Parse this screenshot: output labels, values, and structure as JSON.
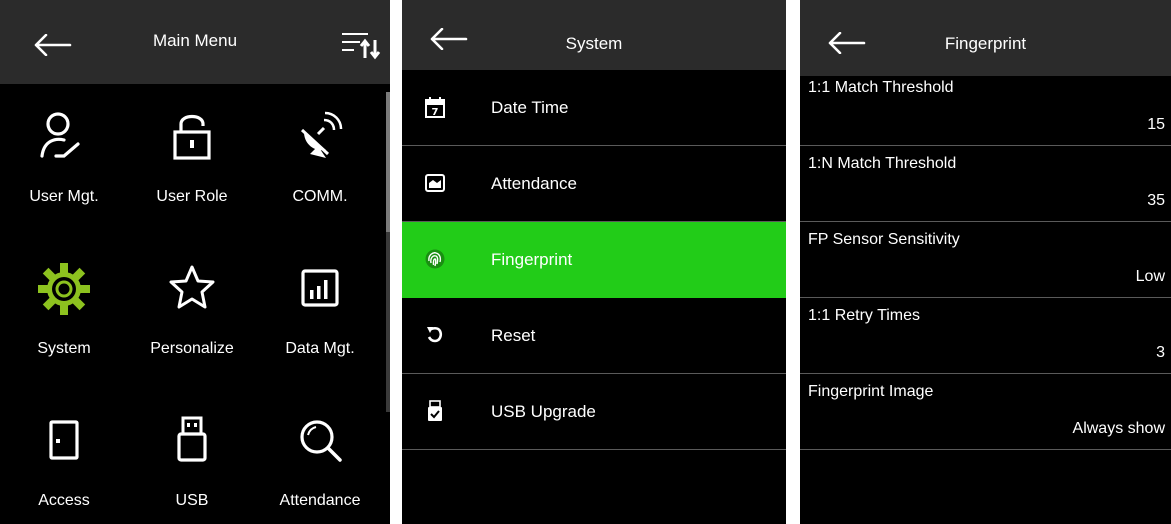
{
  "main_menu": {
    "title": "Main Menu",
    "items": [
      {
        "label": "User Mgt.",
        "icon": "user-icon"
      },
      {
        "label": "User Role",
        "icon": "lock-icon"
      },
      {
        "label": "COMM.",
        "icon": "satellite-dish-icon"
      },
      {
        "label": "System",
        "icon": "gear-icon"
      },
      {
        "label": "Personalize",
        "icon": "star-icon"
      },
      {
        "label": "Data Mgt.",
        "icon": "bar-chart-icon"
      },
      {
        "label": "Access",
        "icon": "door-icon"
      },
      {
        "label": "USB",
        "icon": "usb-drive-icon"
      },
      {
        "label": "Attendance",
        "icon": "magnifier-icon"
      }
    ]
  },
  "system": {
    "title": "System",
    "items": [
      {
        "label": "Date Time",
        "icon": "calendar-icon",
        "calendar_day": "7"
      },
      {
        "label": "Attendance",
        "icon": "attendance-icon"
      },
      {
        "label": "Fingerprint",
        "icon": "fingerprint-icon",
        "selected": true
      },
      {
        "label": "Reset",
        "icon": "reset-icon"
      },
      {
        "label": "USB Upgrade",
        "icon": "usb-upgrade-icon"
      }
    ]
  },
  "fingerprint": {
    "title": "Fingerprint",
    "params": [
      {
        "name": "1:1 Match Threshold",
        "value": "15"
      },
      {
        "name": "1:N Match Threshold",
        "value": "35"
      },
      {
        "name": "FP Sensor Sensitivity",
        "value": "Low"
      },
      {
        "name": "1:1 Retry Times",
        "value": "3"
      },
      {
        "name": "Fingerprint Image",
        "value": "Always show"
      }
    ]
  },
  "colors": {
    "background": "#000000",
    "header": "#2b2b2b",
    "selected": "#22cc18",
    "gear": "#8dc21f",
    "divider": "#5a5a5a"
  }
}
